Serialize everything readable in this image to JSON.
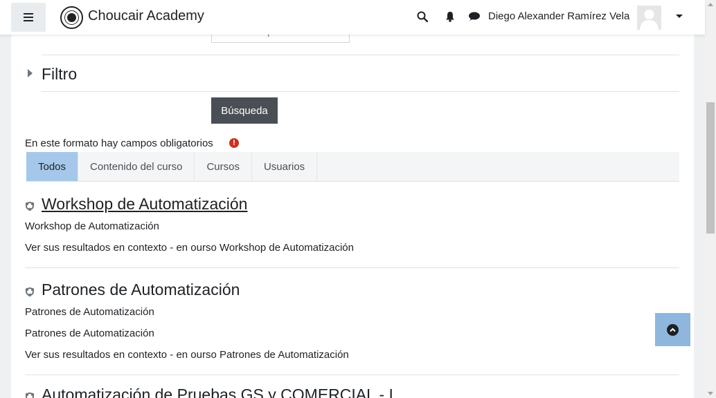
{
  "navbar": {
    "brand": "Choucair Academy",
    "user_name": "Diego Alexander Ramírez Vela",
    "icons": [
      "menu-icon",
      "search-icon",
      "bell-icon",
      "chat-icon",
      "user-avatar",
      "caret-down-icon"
    ]
  },
  "ghost_button": {
    "label": "Workshop de Automatiz"
  },
  "filter": {
    "title": "Filtro"
  },
  "search_button": {
    "label": "Búsqueda"
  },
  "required_note": "En este formato hay campos obligatorios",
  "tabs": [
    {
      "label": "Todos",
      "active": true
    },
    {
      "label": "Contenido del curso",
      "active": false
    },
    {
      "label": "Cursos",
      "active": false
    },
    {
      "label": "Usuarios",
      "active": false
    }
  ],
  "results": [
    {
      "title": "Workshop de Automatización",
      "lines": [
        "Workshop de Automatización",
        "Ver sus resultados en contexto - en ourso Workshop de Automatización"
      ]
    },
    {
      "title": "Patrones de Automatización",
      "lines": [
        "Patrones de Automatización",
        "Patrones de Automatización",
        "Ver sus resultados en contexto - en ourso Patrones de Automatización"
      ]
    },
    {
      "title": "Automatización de Pruebas GS y COMERCIAL - I",
      "lines": []
    }
  ],
  "colors": {
    "active_tab": "#a5c8ea",
    "search_button": "#4a4f55",
    "back_to_top": "#8fb7dd",
    "required_icon": "#ca3120"
  }
}
